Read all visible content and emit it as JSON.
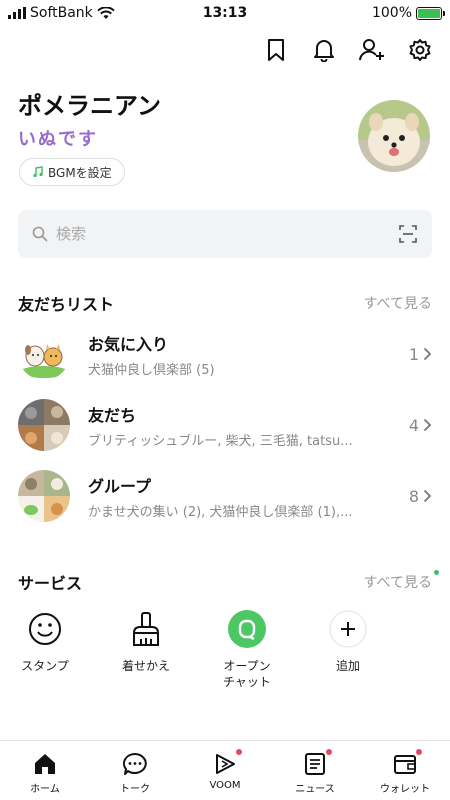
{
  "status_bar": {
    "carrier": "SoftBank",
    "time": "13:13",
    "battery": "100%"
  },
  "top_icons": [
    "bookmark-icon",
    "bell-icon",
    "add-friend-icon",
    "settings-icon"
  ],
  "profile": {
    "name": "ポメラニアン",
    "status_message": "いぬです",
    "bgm_label": "BGMを設定"
  },
  "search": {
    "placeholder": "検索"
  },
  "friends_section": {
    "title": "友だちリスト",
    "see_all": "すべて見る",
    "rows": [
      {
        "name": "お気に入り",
        "sub": "犬猫仲良し倶楽部 (5)",
        "count": "1"
      },
      {
        "name": "友だち",
        "sub": "ブリティッシュブルー, 柴犬, 三毛猫, tatsu...",
        "count": "4"
      },
      {
        "name": "グループ",
        "sub": "かませ犬の集い (2), 犬猫仲良し倶楽部 (1),...",
        "count": "8"
      }
    ]
  },
  "services_section": {
    "title": "サービス",
    "see_all": "すべて見る",
    "items": [
      {
        "label": "スタンプ",
        "icon": "smiley-icon"
      },
      {
        "label": "着せかえ",
        "icon": "brush-icon"
      },
      {
        "label_line1": "オープン",
        "label_line2": "チャット",
        "icon": "openchat-icon"
      },
      {
        "label": "追加",
        "icon": "plus-icon"
      }
    ]
  },
  "tabs": [
    {
      "label": "ホーム",
      "icon": "home-icon",
      "badge": false
    },
    {
      "label": "トーク",
      "icon": "chat-icon",
      "badge": false
    },
    {
      "label": "VOOM",
      "icon": "voom-icon",
      "badge": true
    },
    {
      "label": "ニュース",
      "icon": "news-icon",
      "badge": true
    },
    {
      "label": "ウォレット",
      "icon": "wallet-icon",
      "badge": true
    }
  ],
  "colors": {
    "accent_green": "#3fbf5e",
    "badge_red": "#e64860",
    "openchat_green": "#4cc764"
  }
}
